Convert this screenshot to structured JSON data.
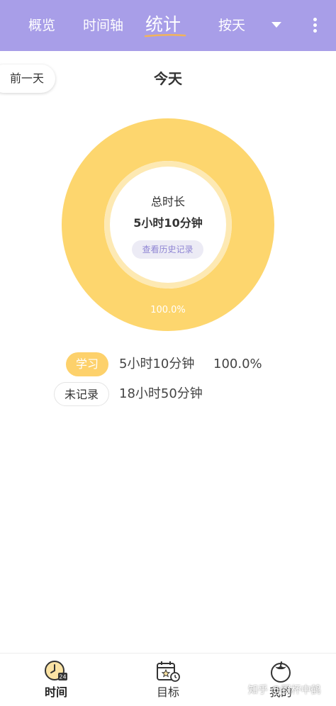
{
  "header": {
    "tabs": [
      {
        "label": "概览",
        "active": false
      },
      {
        "label": "时间轴",
        "active": false
      },
      {
        "label": "统计",
        "active": true
      },
      {
        "label": "按天",
        "active": false
      }
    ],
    "dropdown_icon": "triangle-down-icon",
    "more_icon": "more-vertical-icon",
    "colors": {
      "background": "#a89ee8",
      "underline": "#f2b35a",
      "text": "#ffffff"
    }
  },
  "nav": {
    "prev_label": "前一天",
    "title": "今天"
  },
  "summary": {
    "title": "总时长",
    "value": "5小时10分钟",
    "history_button": "查看历史记录"
  },
  "chart_data": {
    "type": "pie",
    "style": "donut",
    "categories": [
      "学习"
    ],
    "values": [
      100.0
    ],
    "unit": "%",
    "slice_labels": [
      "100.0%"
    ],
    "colors": [
      "#fdd66e"
    ],
    "inner_ring_color": "#fde9b3"
  },
  "legend": [
    {
      "label": "学习",
      "duration": "5小时10分钟",
      "percent": "100.0%",
      "color": "#fdd16b"
    },
    {
      "label": "未记录",
      "duration": "18小时50分钟",
      "percent": "",
      "color": "#ffffff"
    }
  ],
  "bottom_nav": {
    "items": [
      {
        "label": "时间",
        "icon": "clock-24-icon",
        "active": true
      },
      {
        "label": "目标",
        "icon": "calendar-star-icon",
        "active": false
      },
      {
        "label": "我的",
        "icon": "tomato-icon",
        "active": false
      }
    ]
  },
  "watermark": "知乎 @野杯中鹤"
}
